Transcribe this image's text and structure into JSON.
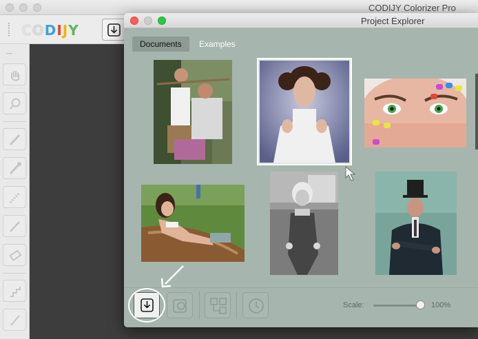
{
  "main_window": {
    "title": "CODIJY Colorizer Pro",
    "logo": [
      "C",
      "O",
      "D",
      "I",
      "J",
      "Y"
    ],
    "logo_colors": [
      "#e8e8e8",
      "#d9d9d9",
      "#3aa3d9",
      "#e5462f",
      "#f5b400",
      "#5cb85c"
    ]
  },
  "project_explorer": {
    "title": "Project Explorer",
    "tabs": [
      {
        "label": "Documents",
        "active": true
      },
      {
        "label": "Examples",
        "active": false
      }
    ],
    "thumbnails": [
      {
        "subject": "two-men-outdoor-photo",
        "colorized": true,
        "selected": false
      },
      {
        "subject": "woman-portrait-with-hair-buns",
        "colorized": true,
        "selected": true
      },
      {
        "subject": "woman-face-colored-nails",
        "colorized": true,
        "selected": false
      },
      {
        "subject": "woman-in-canoe-photo",
        "colorized": true,
        "selected": false
      },
      {
        "subject": "child-in-overalls-photo",
        "colorized": false,
        "selected": false
      },
      {
        "subject": "man-in-top-hat-photo",
        "colorized": true,
        "selected": false
      }
    ],
    "bottom_toolbar": {
      "buttons": [
        "save-icon",
        "export-image-icon",
        "compare-icon",
        "history-icon"
      ]
    },
    "scale": {
      "label": "Scale:",
      "value": "100%",
      "level": 1.0
    }
  },
  "colors": {
    "pe_background": "#a6b5ae",
    "close": "#fe5f57",
    "minimize": "#c8c8c8",
    "zoom": "#2ac940",
    "annotation": "#ffffff"
  }
}
